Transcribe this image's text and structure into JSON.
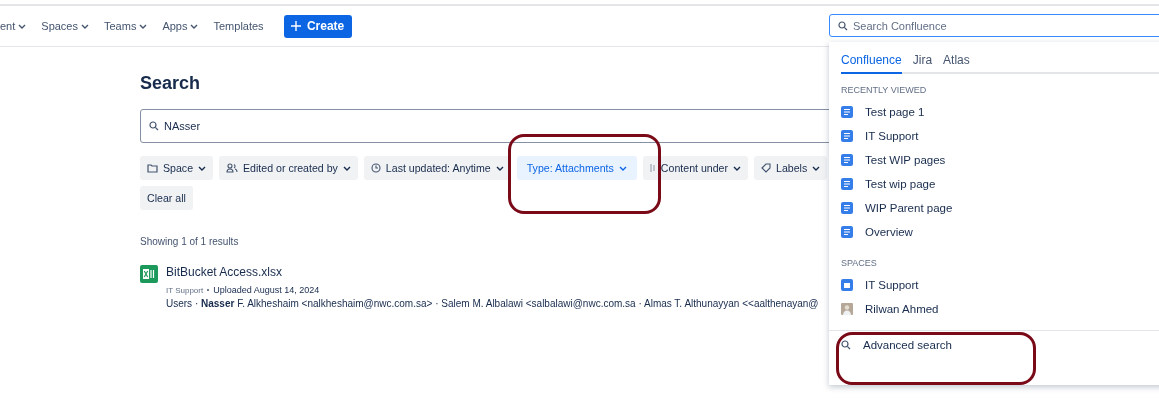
{
  "nav": {
    "items": [
      {
        "label": "ent",
        "dropdown": true
      },
      {
        "label": "Spaces",
        "dropdown": true
      },
      {
        "label": "Teams",
        "dropdown": true
      },
      {
        "label": "Apps",
        "dropdown": true
      },
      {
        "label": "Templates",
        "dropdown": false
      }
    ],
    "create": "Create",
    "search_placeholder": "Search Confluence"
  },
  "title": "Search",
  "query": "NAsser",
  "filters": [
    {
      "label": "Space",
      "selected": false
    },
    {
      "label": "Edited or created by",
      "selected": false
    },
    {
      "label": "Last updated: Anytime",
      "selected": false
    },
    {
      "label": "Type: Attachments",
      "selected": true
    },
    {
      "label": "Content under",
      "selected": false
    },
    {
      "label": "Labels",
      "selected": false
    }
  ],
  "clear": "Clear all",
  "results_count": "Showing 1 of 1 results",
  "result": {
    "title": "BitBucket Access.xlsx",
    "space": "IT Support",
    "meta": "Uploaded August 14, 2024",
    "excerpt": "Users · **Nasser** F. Alkheshaim <nalkheshaim@nwc.com.sa> · Salem M. Albalawi <salbalawi@nwc.com.sa · Almas T. Althunayyan <<aalthenayan@"
  },
  "dropdown": {
    "tabs": [
      {
        "label": "Confluence",
        "selected": true
      },
      {
        "label": "Jira",
        "selected": false
      },
      {
        "label": "Atlas",
        "selected": false
      }
    ],
    "sections": [
      {
        "heading": "RECENTLY VIEWED",
        "items": [
          {
            "label": "Test page 1",
            "kind": "page"
          },
          {
            "label": "IT Support",
            "kind": "page"
          },
          {
            "label": "Test WIP pages",
            "kind": "page"
          },
          {
            "label": "Test wip page",
            "kind": "page"
          },
          {
            "label": "WIP Parent page",
            "kind": "page"
          },
          {
            "label": "Overview",
            "kind": "page"
          }
        ]
      },
      {
        "heading": "SPACES",
        "items": [
          {
            "label": "IT Support",
            "kind": "space"
          },
          {
            "label": "Rilwan Ahmed",
            "kind": "person"
          }
        ]
      }
    ],
    "advanced": "Advanced search"
  }
}
